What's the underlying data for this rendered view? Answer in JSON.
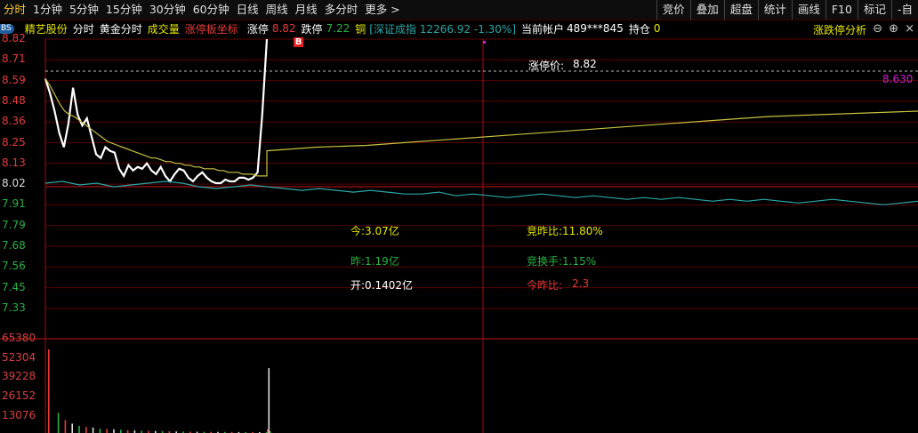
{
  "tabs": [
    "分时",
    "1分钟",
    "5分钟",
    "15分钟",
    "30分钟",
    "60分钟",
    "日线",
    "周线",
    "月线",
    "多分时",
    "更多 >"
  ],
  "active_tab": "分时",
  "tools": [
    "竞价",
    "叠加",
    "超盘",
    "统计",
    "画线",
    "F10",
    "标记",
    "-自"
  ],
  "info": {
    "bs": "BS",
    "stock": "精艺股份",
    "mode": "分时",
    "golden": "黄金分时",
    "volume": "成交量",
    "limit_board": "涨停板坐标",
    "limit_up_label": "涨停",
    "limit_up_value": "8.82",
    "limit_down_label": "跌停",
    "limit_down_value": "7.22",
    "copper": "铜",
    "index": "[深证成指 12266.92 -1.30%]",
    "account_label": "当前帐户",
    "account_value": "489***845",
    "position_label": "持仓",
    "position_value": "0",
    "analysis": "涨跌停分析"
  },
  "corner_icons": [
    "minus-circle-icon",
    "plus-circle-icon",
    "close-icon"
  ],
  "y_prices": [
    {
      "v": "8.82",
      "c": "up"
    },
    {
      "v": "8.71",
      "c": "up"
    },
    {
      "v": "8.59",
      "c": "up"
    },
    {
      "v": "8.48",
      "c": "up"
    },
    {
      "v": "8.36",
      "c": "up"
    },
    {
      "v": "8.25",
      "c": "up"
    },
    {
      "v": "8.13",
      "c": "up"
    },
    {
      "v": "8.02",
      "c": "base"
    },
    {
      "v": "7.91",
      "c": "dn"
    },
    {
      "v": "7.79",
      "c": "dn"
    },
    {
      "v": "7.68",
      "c": "dn"
    },
    {
      "v": "7.56",
      "c": "dn"
    },
    {
      "v": "7.45",
      "c": "dn"
    },
    {
      "v": "7.33",
      "c": "dn"
    }
  ],
  "y_volume": [
    "65380",
    "52304",
    "39228",
    "26152",
    "13076"
  ],
  "limit_price_label": "涨停价:",
  "limit_price_value": "8.82",
  "right_price": "8.630",
  "b_marker": "B",
  "stats": {
    "today": "今:3.07亿",
    "yesterday": "昨:1.19亿",
    "open": "开:0.1402亿",
    "auction_ratio": "竞昨比:11.80%",
    "auction_turnover": "竞换手:1.15%",
    "today_ratio_label": "今昨比:",
    "today_ratio_value": "2.3"
  },
  "colors": {
    "up": "#e63b3b",
    "down": "#28b040",
    "yellow": "#e8e800",
    "avg": "#c8c040",
    "index": "#2aa6a6",
    "magenta": "#d020d0"
  },
  "chart_data": {
    "type": "line",
    "title": "",
    "xlabel": "",
    "ylabel": "",
    "ylim": [
      7.22,
      8.82
    ],
    "base_price": 8.02,
    "series": [
      {
        "values": [
          8.6,
          8.52,
          8.42,
          8.3,
          8.22,
          8.35,
          8.55,
          8.4,
          8.34,
          8.38,
          8.28,
          8.18,
          8.16,
          8.22,
          8.2,
          8.19,
          8.1,
          8.06,
          8.12,
          8.09,
          8.11,
          8.1,
          8.13,
          8.09,
          8.07,
          8.11,
          8.06,
          8.03,
          8.07,
          8.1,
          8.09,
          8.05,
          8.03,
          8.06,
          8.08,
          8.05,
          8.03,
          8.02,
          8.02,
          8.04,
          8.03,
          8.03,
          8.05,
          8.05,
          8.04,
          8.05,
          8.08,
          8.4,
          8.82
        ]
      },
      {
        "values": [
          8.6,
          8.56,
          8.51,
          8.46,
          8.42,
          8.4,
          8.39,
          8.37,
          8.35,
          8.33,
          8.31,
          8.29,
          8.27,
          8.25,
          8.24,
          8.23,
          8.22,
          8.21,
          8.2,
          8.19,
          8.18,
          8.17,
          8.16,
          8.16,
          8.15,
          8.14,
          8.14,
          8.13,
          8.13,
          8.12,
          8.12,
          8.11,
          8.11,
          8.1,
          8.1,
          8.1,
          8.09,
          8.09,
          8.08,
          8.08,
          8.08,
          8.07,
          8.07,
          8.07,
          8.06,
          8.06,
          8.06,
          8.2,
          8.22,
          8.23,
          8.25,
          8.27,
          8.29,
          8.31,
          8.33,
          8.35,
          8.37,
          8.39,
          8.4,
          8.41,
          8.42
        ]
      },
      {
        "values": [
          8.02,
          8.03,
          8.01,
          8.02,
          8.0,
          8.01,
          8.02,
          8.03,
          8.02,
          8.0,
          7.99,
          8.0,
          8.01,
          8.0,
          7.99,
          7.98,
          7.99,
          7.98,
          7.97,
          7.98,
          7.97,
          7.96,
          7.96,
          7.97,
          7.95,
          7.96,
          7.95,
          7.94,
          7.95,
          7.96,
          7.95,
          7.94,
          7.95,
          7.94,
          7.93,
          7.94,
          7.93,
          7.94,
          7.93,
          7.92,
          7.93,
          7.92,
          7.93,
          7.92,
          7.91,
          7.92,
          7.93,
          7.92,
          7.91,
          7.9,
          7.91,
          7.92
        ]
      }
    ],
    "volume": {
      "ylim": [
        0,
        65380
      ],
      "values": [
        58000,
        14000,
        9000,
        6500,
        5000,
        4200,
        3800,
        3000,
        2800,
        2600,
        2200,
        2000,
        1800,
        1600,
        1500,
        1400,
        1300,
        1200,
        1100,
        1000,
        950,
        900,
        850,
        800,
        800,
        750,
        700,
        700,
        650,
        600,
        600,
        550,
        2500,
        45000,
        1200
      ]
    }
  }
}
